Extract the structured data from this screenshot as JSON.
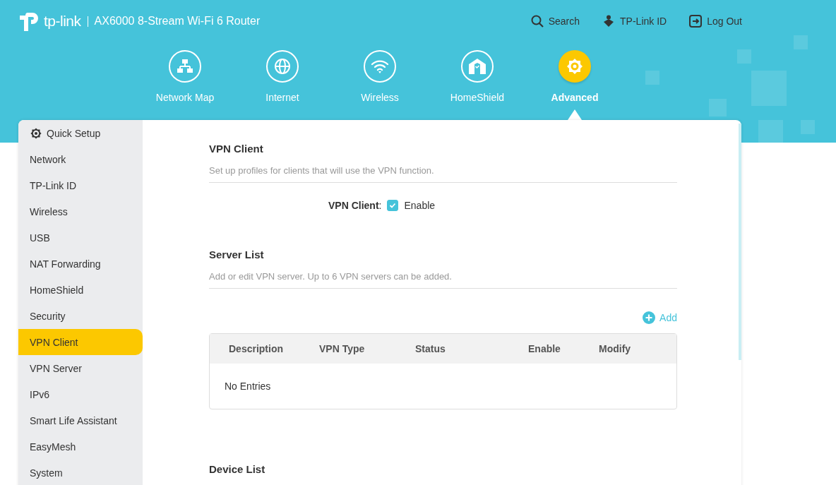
{
  "header": {
    "brand": "tp-link",
    "model": "AX6000 8-Stream Wi-Fi 6 Router",
    "links": [
      {
        "kind": "search",
        "label": "Search"
      },
      {
        "kind": "account",
        "label": "TP-Link ID"
      },
      {
        "kind": "logout",
        "label": "Log Out"
      }
    ]
  },
  "nav_tabs": [
    {
      "kind": "network-map",
      "label": "Network Map",
      "selected": false
    },
    {
      "kind": "internet",
      "label": "Internet",
      "selected": false
    },
    {
      "kind": "wireless",
      "label": "Wireless",
      "selected": false
    },
    {
      "kind": "homeshield",
      "label": "HomeShield",
      "selected": false
    },
    {
      "kind": "advanced",
      "label": "Advanced",
      "selected": true
    }
  ],
  "sidebar": {
    "items": [
      {
        "kind": "setup",
        "label": "Quick Setup",
        "selected": false
      },
      {
        "label": "Network",
        "selected": false
      },
      {
        "label": "TP-Link ID",
        "selected": false
      },
      {
        "label": "Wireless",
        "selected": false
      },
      {
        "label": "USB",
        "selected": false
      },
      {
        "label": "NAT Forwarding",
        "selected": false
      },
      {
        "label": "HomeShield",
        "selected": false
      },
      {
        "label": "Security",
        "selected": false
      },
      {
        "label": "VPN Client",
        "selected": true
      },
      {
        "label": "VPN Server",
        "selected": false
      },
      {
        "label": "IPv6",
        "selected": false
      },
      {
        "label": "Smart Life Assistant",
        "selected": false
      },
      {
        "label": "EasyMesh",
        "selected": false
      },
      {
        "label": "System",
        "selected": false
      }
    ]
  },
  "vpn_client": {
    "title": "VPN Client",
    "description": "Set up profiles for clients that will use the VPN function.",
    "field_label": "VPN Client",
    "separator": ":",
    "option_label": "Enable",
    "checked": true
  },
  "server_list": {
    "title": "Server List",
    "description": "Add or edit VPN server. Up to 6 VPN servers can be added.",
    "add_button": "Add",
    "table": {
      "columns": [
        "Description",
        "VPN Type",
        "Status",
        "Enable",
        "Modify"
      ],
      "empty_text": "No Entries"
    }
  },
  "device_list": {
    "title": "Device List"
  }
}
